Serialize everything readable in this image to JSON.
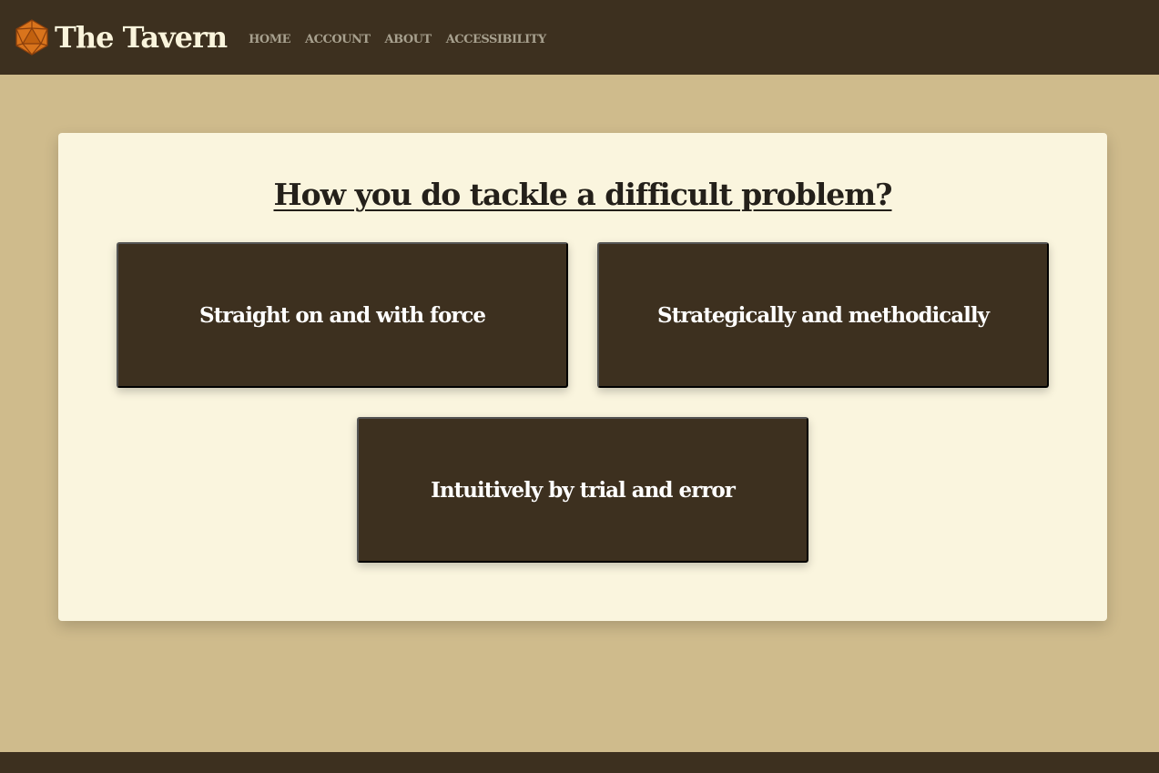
{
  "brand": {
    "name": "The Tavern",
    "icon": "d20-dice-icon",
    "icon_color": "#d9741c"
  },
  "nav": {
    "items": [
      {
        "label": "HOME"
      },
      {
        "label": "ACCOUNT"
      },
      {
        "label": "ABOUT"
      },
      {
        "label": "ACCESSIBILITY"
      }
    ]
  },
  "quiz": {
    "question": "How you do tackle a difficult problem?",
    "answers": [
      {
        "label": "Straight on and with force"
      },
      {
        "label": "Strategically and methodically"
      },
      {
        "label": "Intuitively by trial and error"
      }
    ]
  },
  "colors": {
    "header_bg": "#3d301f",
    "page_bg": "#cfbb8c",
    "card_bg": "#faf5de",
    "button_bg": "#3d301f",
    "nav_text": "#a7a08e",
    "brand_text": "#faf4dc"
  }
}
